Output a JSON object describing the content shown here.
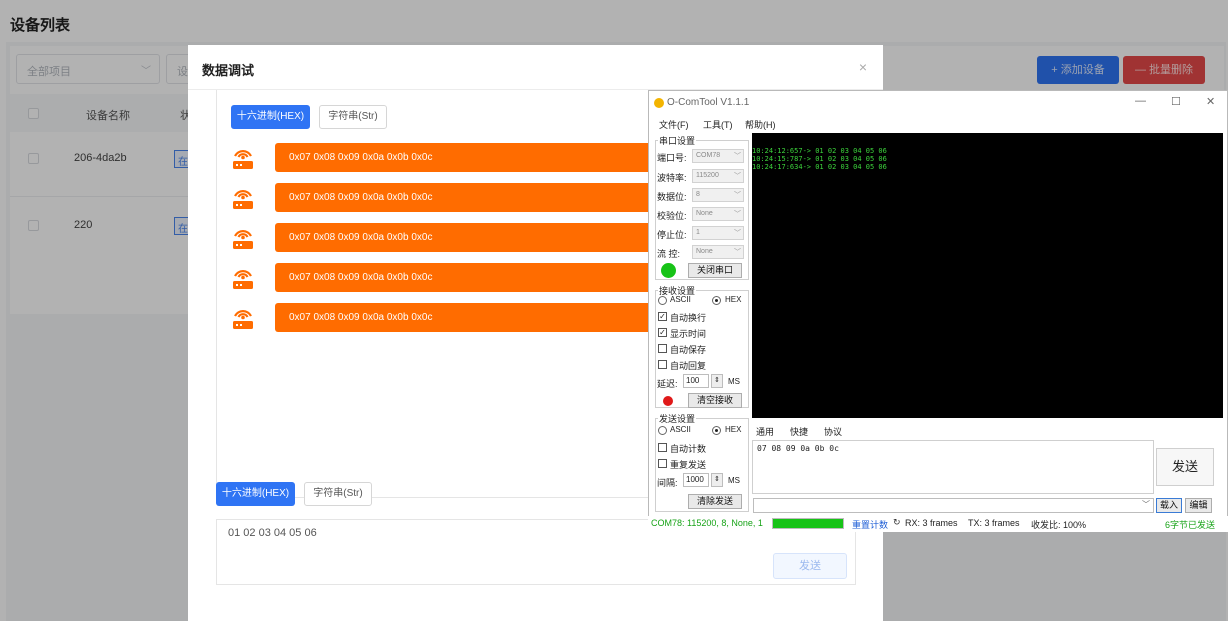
{
  "page": {
    "title": "设备列表",
    "filter_project": "全部项目",
    "filter_second": "设",
    "add_device": "+ 添加设备",
    "batch_delete": "— 批量删除",
    "table_headers": [
      "设备名称",
      "状"
    ],
    "rows": [
      {
        "name": "206-4da2b",
        "tag": "在"
      },
      {
        "name": "220",
        "tag": "在"
      }
    ]
  },
  "modal": {
    "title": "数据调试",
    "close": "×",
    "tab_hex": "十六进制(HEX)",
    "tab_str": "字符串(Str)",
    "messages": [
      "0x07 0x08 0x09 0x0a 0x0b 0x0c",
      "0x07 0x08 0x09 0x0a 0x0b 0x0c",
      "0x07 0x08 0x09 0x0a 0x0b 0x0c",
      "0x07 0x08 0x09 0x0a 0x0b 0x0c",
      "0x07 0x08 0x09 0x0a 0x0b 0x0c"
    ],
    "send_text": "01 02 03 04 05 06",
    "send_button": "发送"
  },
  "tool": {
    "title": "O-ComTool V1.1.1",
    "window_min": "—",
    "window_max": "☐",
    "window_close": "✕",
    "menu": [
      "文件(F)",
      "工具(T)",
      "帮助(H)"
    ],
    "serial_group": "串口设置",
    "port_label": "端口号:",
    "port_value": "COM78",
    "baud_label": "波特率:",
    "baud_value": "115200",
    "data_label": "数据位:",
    "data_value": "8",
    "parity_label": "校验位:",
    "parity_value": "None",
    "stop_label": "停止位:",
    "stop_value": "1",
    "flow_label": "流  控:",
    "flow_value": "None",
    "close_port": "关闭串口",
    "recv_group": "接收设置",
    "ascii": "ASCII",
    "hex": "HEX",
    "auto_newline": "自动换行",
    "show_time": "显示时间",
    "auto_save": "自动保存",
    "auto_reply": "自动回复",
    "delay_label": "延迟:",
    "delay_value": "100",
    "ms": "MS",
    "clear_recv": "清空接收",
    "send_group": "发送设置",
    "auto_count": "自动计数",
    "repeat_send": "重复发送",
    "interval_label": "间隔:",
    "interval_value": "1000",
    "clear_send": "清除发送",
    "log": [
      "10:24:12:657-> 01 02 03 04 05 06",
      "10:24:15:787-> 01 02 03 04 05 06",
      "10:24:17:634-> 01 02 03 04 05 06"
    ],
    "tabs": [
      "通用",
      "快捷",
      "协议"
    ],
    "send_input": "07 08 09 0a 0b 0c",
    "send_button": "发送",
    "load_button": "载入",
    "edit_button": "编辑",
    "status_port": "COM78: 115200, 8, None, 1",
    "reset_count": "重置计数",
    "rx": "RX: 3 frames",
    "tx": "TX: 3 frames",
    "ratio": "收发比: 100%",
    "sent": "6字节已发送",
    "progress": 1.0,
    "colors": {
      "terminal_bg": "#000000",
      "terminal_text": "#3cd43c",
      "status_green": "#17c317",
      "link_blue": "#1f5fd6"
    }
  }
}
